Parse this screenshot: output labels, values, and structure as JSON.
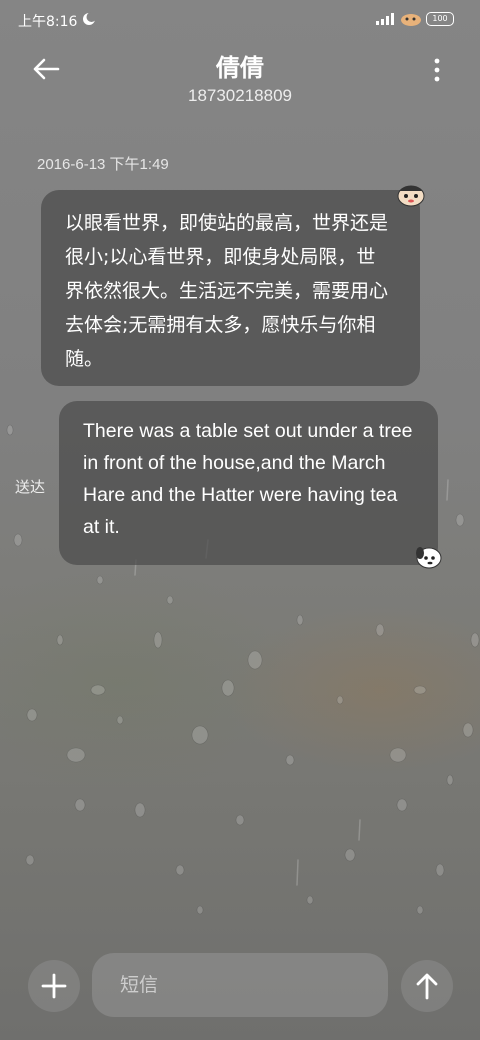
{
  "status_bar": {
    "time": "上午8:16",
    "battery": "100"
  },
  "header": {
    "contact_name": "倩倩",
    "phone_number": "18730218809"
  },
  "conversation": {
    "timestamp": "2016-6-13 下午1:49",
    "messages": [
      {
        "direction": "incoming",
        "text": "以眼看世界，即使站的最高，世界还是很小;以心看世界，即使身处局限，世界依然很大。生活远不完美，需要用心去体会;无需拥有太多，愿快乐与你相随。"
      },
      {
        "direction": "outgoing",
        "text": "There was a table set out under a tree in front of the house,and the March Hare and the Hatter were having tea at it.",
        "status": "送达"
      }
    ]
  },
  "composer": {
    "placeholder": "短信"
  },
  "icons": {
    "back": "back-arrow-icon",
    "more": "more-vertical-icon",
    "add": "plus-icon",
    "send": "send-arrow-icon",
    "dnd": "moon-icon"
  }
}
